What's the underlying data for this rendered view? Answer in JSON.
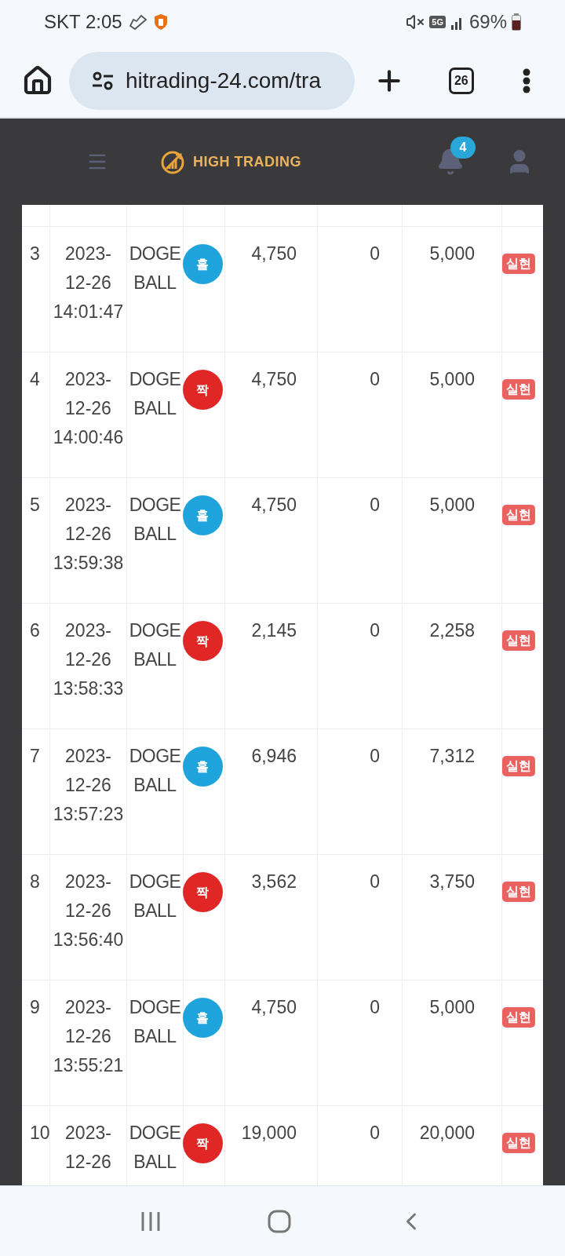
{
  "status_bar": {
    "carrier_time": "SKT 2:05",
    "network": "5G",
    "battery": "69%"
  },
  "browser": {
    "url": "hitrading-24.com/tra",
    "tab_count": "26"
  },
  "header": {
    "brand": "HIGH TRADING",
    "notification_count": "4"
  },
  "rows": [
    {
      "no": "3",
      "date": "2023-12-26",
      "time": "14:01:47",
      "coin": "DOGE BALL",
      "ball": {
        "label": "홀",
        "color": "#1ea3dc"
      },
      "amount": "4,750",
      "fee": "0",
      "total": "5,000",
      "status": "실현"
    },
    {
      "no": "4",
      "date": "2023-12-26",
      "time": "14:00:46",
      "coin": "DOGE BALL",
      "ball": {
        "label": "짝",
        "color": "#e12626"
      },
      "amount": "4,750",
      "fee": "0",
      "total": "5,000",
      "status": "실현"
    },
    {
      "no": "5",
      "date": "2023-12-26",
      "time": "13:59:38",
      "coin": "DOGE BALL",
      "ball": {
        "label": "홀",
        "color": "#1ea3dc"
      },
      "amount": "4,750",
      "fee": "0",
      "total": "5,000",
      "status": "실현"
    },
    {
      "no": "6",
      "date": "2023-12-26",
      "time": "13:58:33",
      "coin": "DOGE BALL",
      "ball": {
        "label": "짝",
        "color": "#e12626"
      },
      "amount": "2,145",
      "fee": "0",
      "total": "2,258",
      "status": "실현"
    },
    {
      "no": "7",
      "date": "2023-12-26",
      "time": "13:57:23",
      "coin": "DOGE BALL",
      "ball": {
        "label": "홀",
        "color": "#1ea3dc"
      },
      "amount": "6,946",
      "fee": "0",
      "total": "7,312",
      "status": "실현"
    },
    {
      "no": "8",
      "date": "2023-12-26",
      "time": "13:56:40",
      "coin": "DOGE BALL",
      "ball": {
        "label": "짝",
        "color": "#e12626"
      },
      "amount": "3,562",
      "fee": "0",
      "total": "3,750",
      "status": "실현"
    },
    {
      "no": "9",
      "date": "2023-12-26",
      "time": "13:55:21",
      "coin": "DOGE BALL",
      "ball": {
        "label": "홀",
        "color": "#1ea3dc"
      },
      "amount": "4,750",
      "fee": "0",
      "total": "5,000",
      "status": "실현"
    },
    {
      "no": "10",
      "date": "2023-12-26",
      "coin": "DOGE BALL",
      "ball": {
        "label": "짝",
        "color": "#e12626"
      },
      "amount": "19,000",
      "fee": "0",
      "total": "20,000",
      "status": "실현"
    }
  ]
}
